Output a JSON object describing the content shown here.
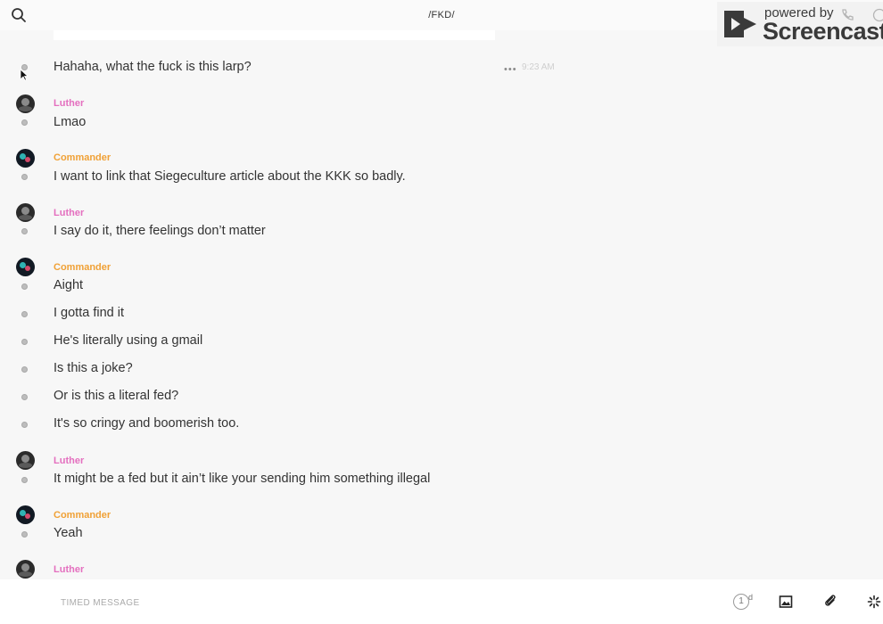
{
  "header": {
    "title": "/FKD/"
  },
  "watermark": {
    "powered": "powered by",
    "brand": "Screencastify"
  },
  "messages": [
    {
      "text": "Hahaha, what the fuck is this larp?",
      "time": "9:23 AM"
    },
    {
      "author": "Luther",
      "text": "Lmao"
    },
    {
      "author": "Commander",
      "text": "I want to link that Siegeculture article about the KKK so badly."
    },
    {
      "author": "Luther",
      "text": "I say do it, there feelings don’t matter"
    },
    {
      "author": "Commander",
      "text": "Aight"
    },
    {
      "text": "I gotta find it"
    },
    {
      "text": "He's literally using a gmail"
    },
    {
      "text": "Is this a joke?"
    },
    {
      "text": "Or is this a literal fed?"
    },
    {
      "text": "It's so cringy and boomerish too."
    },
    {
      "author": "Luther",
      "text": "It might be a fed but it ain’t like your sending him something illegal"
    },
    {
      "author": "Commander",
      "text": "Yeah"
    },
    {
      "author": "Luther"
    }
  ],
  "composer": {
    "placeholder": "TIMED MESSAGE",
    "timer_value": "1",
    "timer_unit": "d"
  },
  "colors": {
    "luther": "#e46fbf",
    "commander": "#f0a136",
    "background": "#f7f7f7"
  },
  "icons": [
    "search-icon",
    "phone-icon",
    "info-icon",
    "more-icon",
    "timer-icon",
    "image-icon",
    "paperclip-icon",
    "sparkle-icon"
  ]
}
